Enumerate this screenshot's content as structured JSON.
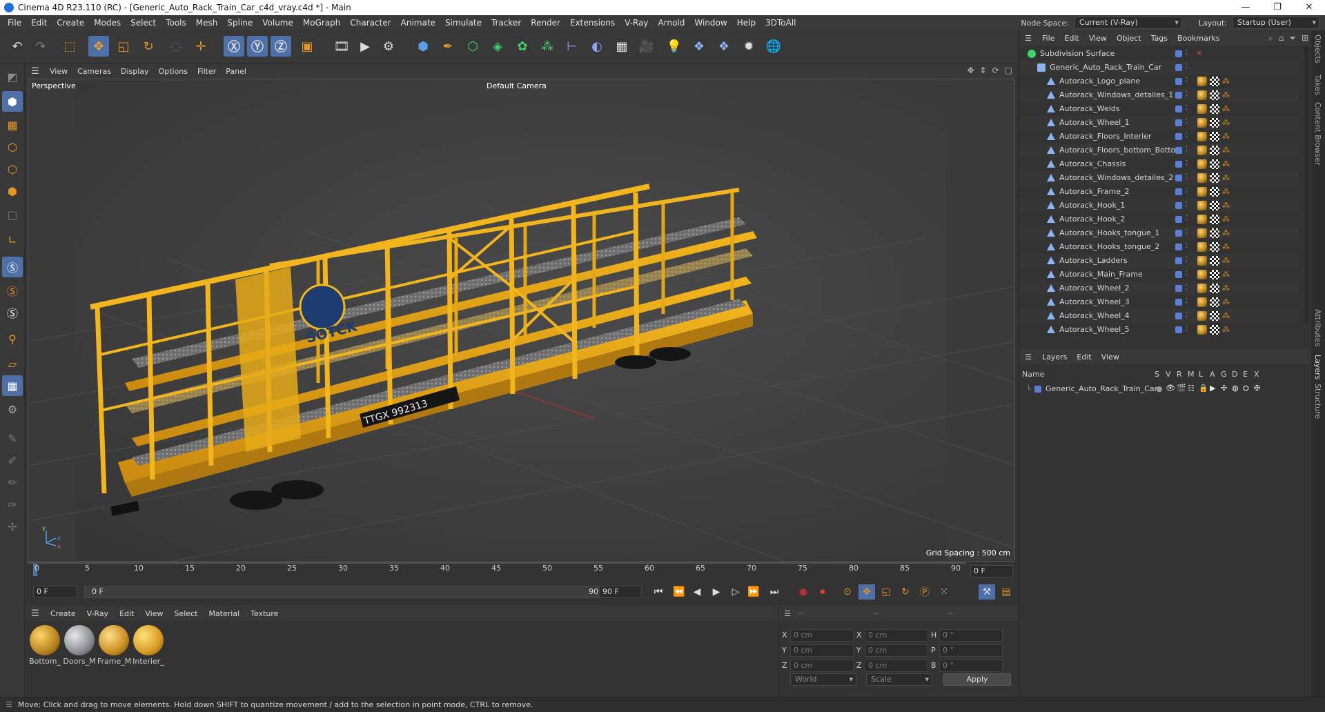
{
  "window": {
    "title": "Cinema 4D R23.110 (RC) - [Generic_Auto_Rack_Train_Car_c4d_vray.c4d *] - Main",
    "controls": [
      "—",
      "❐",
      "✕"
    ]
  },
  "menubar": {
    "items": [
      "File",
      "Edit",
      "Create",
      "Modes",
      "Select",
      "Tools",
      "Mesh",
      "Spline",
      "Volume",
      "MoGraph",
      "Character",
      "Animate",
      "Simulate",
      "Tracker",
      "Render",
      "Extensions",
      "V-Ray",
      "Arnold",
      "Window",
      "Help",
      "3DToAll"
    ],
    "node_space_label": "Node Space:",
    "node_space_value": "Current (V-Ray)",
    "layout_label": "Layout:",
    "layout_value": "Startup (User)"
  },
  "viewport": {
    "menu": [
      "View",
      "Cameras",
      "Display",
      "Options",
      "Filter",
      "Panel"
    ],
    "mode_label": "Perspective",
    "camera_label": "Default Camera",
    "grid_spacing": "Grid Spacing : 500 cm",
    "decal_logo_text": "SOTCK",
    "decal_number": "TTGX 992313"
  },
  "timeline": {
    "ticks": [
      "0",
      "5",
      "10",
      "15",
      "20",
      "25",
      "30",
      "35",
      "40",
      "45",
      "50",
      "55",
      "60",
      "65",
      "70",
      "75",
      "80",
      "85",
      "90"
    ],
    "current_frame": "0 F"
  },
  "transport": {
    "start_field": "0 F",
    "range_start": "0 F",
    "range_end": "90 F",
    "end_field": "90 F"
  },
  "material_manager": {
    "menu": [
      "Create",
      "V-Ray",
      "Edit",
      "View",
      "Select",
      "Material",
      "Texture"
    ],
    "materials": [
      {
        "label": "Bottom_",
        "color": "#b8821e"
      },
      {
        "label": "Doors_M",
        "color": "#8a8d92"
      },
      {
        "label": "Frame_M",
        "color": "#c98d22"
      },
      {
        "label": "Interier_",
        "color": "#d79a24"
      }
    ]
  },
  "coordinates": {
    "header_cols": [
      "--",
      "--",
      "--"
    ],
    "rows": [
      {
        "l1": "X",
        "v1": "0 cm",
        "l2": "X",
        "v2": "0 cm",
        "l3": "H",
        "v3": "0 °"
      },
      {
        "l1": "Y",
        "v1": "0 cm",
        "l2": "Y",
        "v2": "0 cm",
        "l3": "P",
        "v3": "0 °"
      },
      {
        "l1": "Z",
        "v1": "0 cm",
        "l2": "Z",
        "v2": "0 cm",
        "l3": "B",
        "v3": "0 °"
      }
    ],
    "world_select": "World",
    "scale_select": "Scale",
    "apply_label": "Apply"
  },
  "object_manager": {
    "menu": [
      "File",
      "Edit",
      "View",
      "Object",
      "Tags",
      "Bookmarks"
    ],
    "objects": [
      {
        "name": "Subdivision Surface",
        "indent": 0
      },
      {
        "name": "Generic_Auto_Rack_Train_Car",
        "indent": 1
      },
      {
        "name": "Autorack_Logo_plane",
        "indent": 2
      },
      {
        "name": "Autorack_Windows_detailes_1",
        "indent": 2
      },
      {
        "name": "Autorack_Welds",
        "indent": 2
      },
      {
        "name": "Autorack_Wheel_1",
        "indent": 2
      },
      {
        "name": "Autorack_Floors_Interier",
        "indent": 2
      },
      {
        "name": "Autorack_Floors_bottom_Bottom",
        "indent": 2
      },
      {
        "name": "Autorack_Chassis",
        "indent": 2
      },
      {
        "name": "Autorack_Windows_detailes_2",
        "indent": 2
      },
      {
        "name": "Autorack_Frame_2",
        "indent": 2
      },
      {
        "name": "Autorack_Hook_1",
        "indent": 2
      },
      {
        "name": "Autorack_Hook_2",
        "indent": 2
      },
      {
        "name": "Autorack_Hooks_tongue_1",
        "indent": 2
      },
      {
        "name": "Autorack_Hooks_tongue_2",
        "indent": 2
      },
      {
        "name": "Autorack_Ladders",
        "indent": 2
      },
      {
        "name": "Autorack_Main_Frame",
        "indent": 2
      },
      {
        "name": "Autorack_Wheel_2",
        "indent": 2
      },
      {
        "name": "Autorack_Wheel_3",
        "indent": 2
      },
      {
        "name": "Autorack_Wheel_4",
        "indent": 2
      },
      {
        "name": "Autorack_Wheel_5",
        "indent": 2
      }
    ]
  },
  "layer_manager": {
    "menu": [
      "Layers",
      "Edit",
      "View"
    ],
    "col_name": "Name",
    "cols": [
      "S",
      "V",
      "R",
      "M",
      "L",
      "A",
      "G",
      "D",
      "E",
      "X"
    ],
    "layer_name": "Generic_Auto_Rack_Train_Car"
  },
  "side_tabs": [
    "Objects",
    "Takes",
    "Content Browser",
    "Attributes",
    "Layers",
    "Structure"
  ],
  "status": {
    "message": "Move: Click and drag to move elements. Hold down SHIFT to quantize movement / add to the selection in point mode, CTRL to remove."
  }
}
